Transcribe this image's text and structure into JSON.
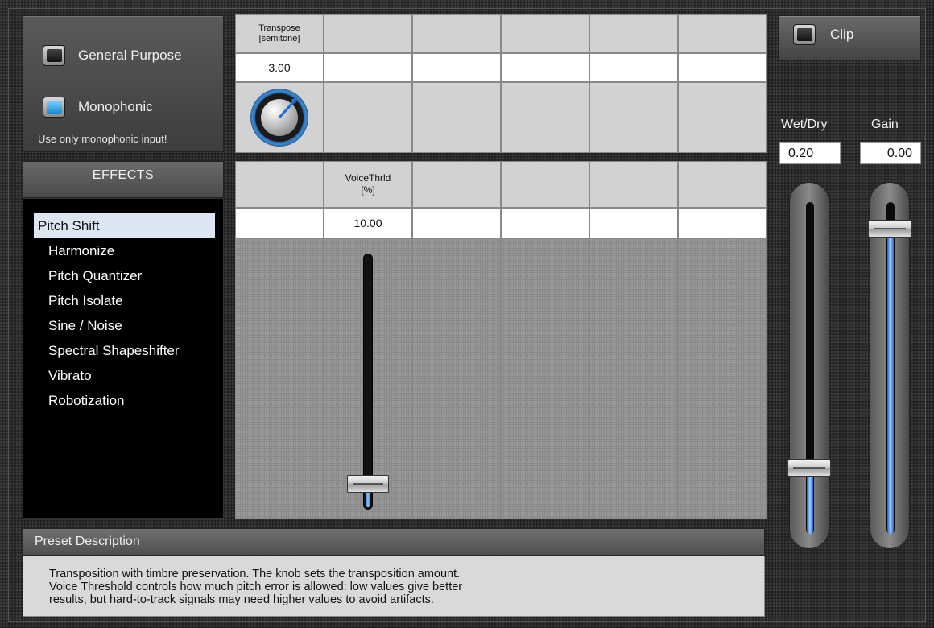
{
  "mode": {
    "general_purpose": {
      "label": "General Purpose",
      "checked": false
    },
    "monophonic": {
      "label": "Monophonic",
      "checked": true
    },
    "note": "Use only monophonic input!"
  },
  "effects": {
    "header": "EFFECTS",
    "items": [
      {
        "label": "Pitch Shift",
        "selected": true
      },
      {
        "label": "Harmonize"
      },
      {
        "label": "Pitch Quantizer"
      },
      {
        "label": "Pitch Isolate"
      },
      {
        "label": "Sine / Noise"
      },
      {
        "label": "Spectral Shapeshifter"
      },
      {
        "label": "Vibrato"
      },
      {
        "label": "Robotization"
      }
    ]
  },
  "params_top": {
    "transpose": {
      "label_line1": "Transpose",
      "label_line2": "[semitone]",
      "value": "3.00"
    }
  },
  "params_bottom": {
    "voice_threshold": {
      "label_line1": "VoiceThrld",
      "label_line2": "[%]",
      "value": "10.00",
      "level": 0.1
    }
  },
  "clip": {
    "label": "Clip",
    "checked": false
  },
  "master": {
    "wet_dry": {
      "label": "Wet/Dry",
      "value": "0.20",
      "level": 0.2
    },
    "gain": {
      "label": "Gain",
      "value": "0.00",
      "level": 0.92
    }
  },
  "preset": {
    "header": "Preset Description",
    "lines": [
      "Transposition with timbre preservation. The knob sets the transposition amount.",
      "Voice Threshold controls how much pitch error is allowed: low values give better",
      "results, but hard-to-track signals may need higher values to avoid artifacts."
    ]
  },
  "colors": {
    "accent": "#3d8ad8",
    "fill": "#8ec8ff",
    "selected_row": "#dbe6f2"
  }
}
